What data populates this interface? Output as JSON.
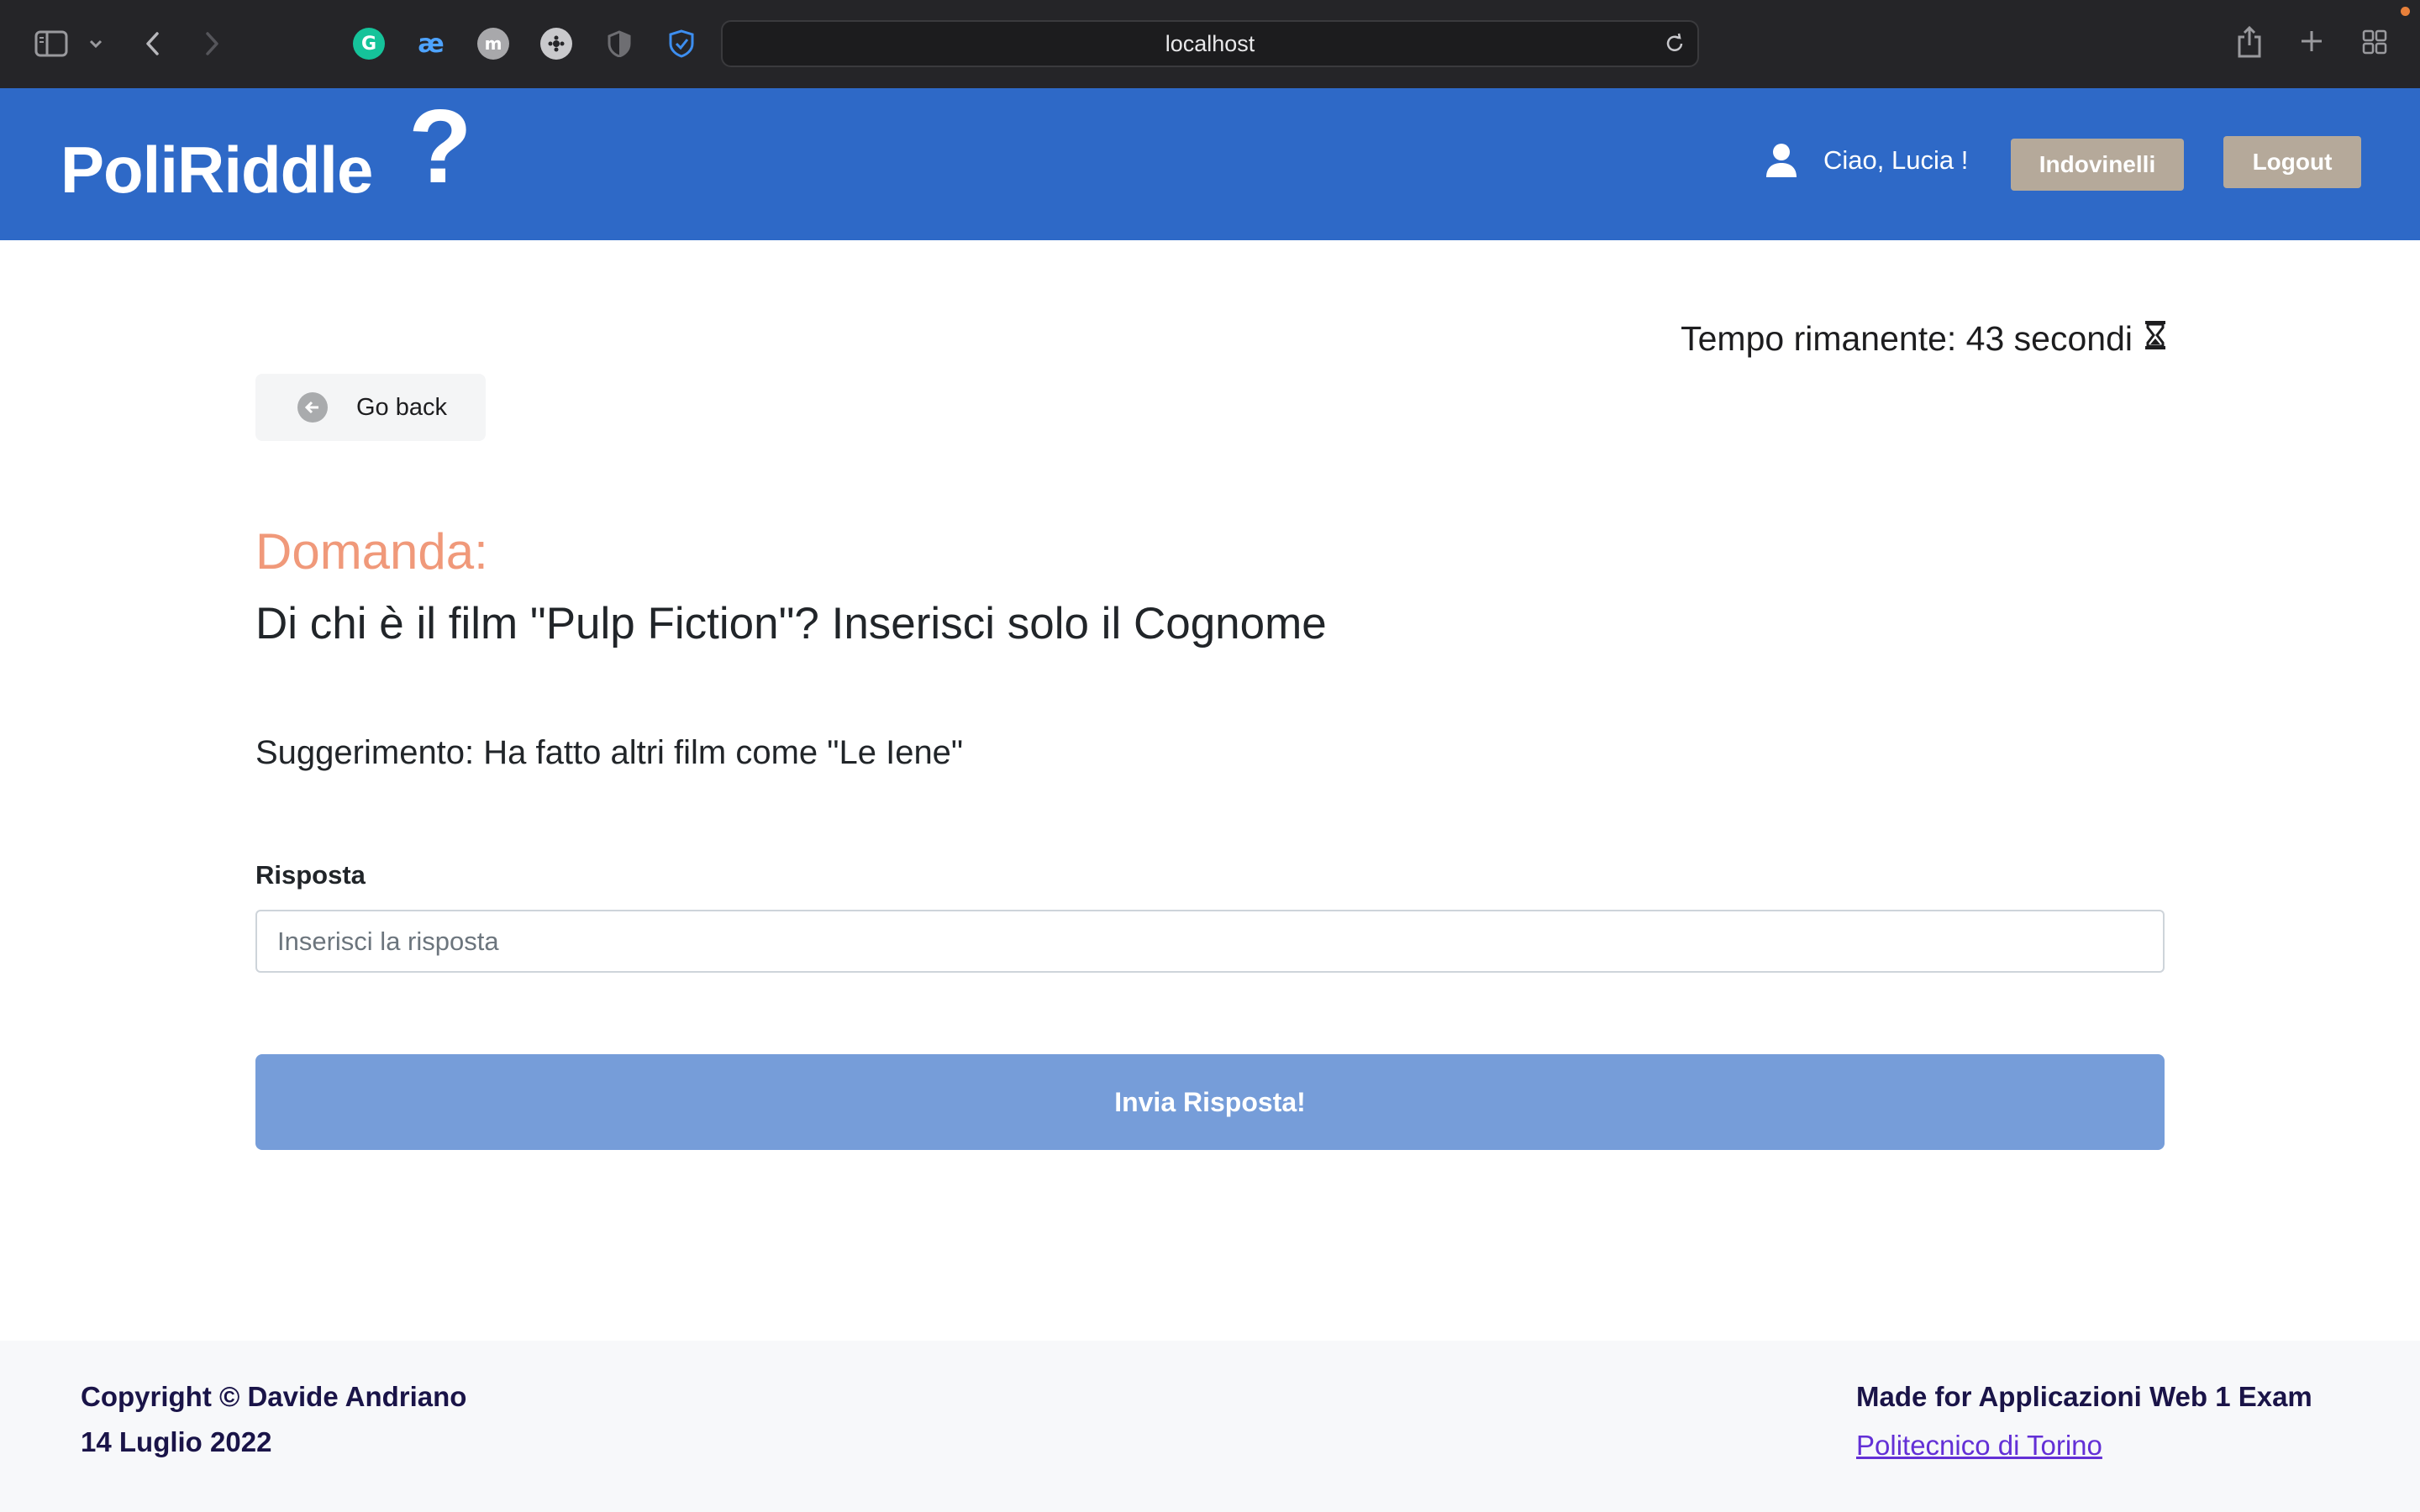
{
  "browser": {
    "url": "localhost",
    "colors": {
      "chrome_bg": "#252528"
    }
  },
  "navbar": {
    "brand": "PoliRiddle",
    "brand_mark": "?",
    "greeting": "Ciao, Lucia !",
    "riddles_button": "Indovinelli",
    "logout_button": "Logout",
    "colors": {
      "background": "#2e69c7",
      "button": "#b5a99a"
    }
  },
  "main": {
    "timer": "Tempo rimanente: 43 secondi",
    "go_back": "Go back",
    "question_label": "Domanda:",
    "question_text": "Di chi è il film \"Pulp Fiction\"? Inserisci solo il Cognome",
    "hint": "Suggerimento: Ha fatto altri film come \"Le Iene\"",
    "answer_label": "Risposta",
    "answer_placeholder": "Inserisci la risposta",
    "answer_value": "",
    "submit_button": "Invia Risposta!",
    "colors": {
      "question_label": "#f0997a",
      "submit": "#769dd9"
    }
  },
  "footer": {
    "copyright": "Copyright © Davide Andriano",
    "date": "14 Luglio 2022",
    "made_for": "Made for Applicazioni Web 1 Exam",
    "university_link": "Politecnico di Torino"
  },
  "icons": [
    "sidebar-icon",
    "chevron-down-icon",
    "back-arrow-icon",
    "forward-arrow-icon",
    "reload-icon",
    "share-icon",
    "plus-icon",
    "tab-overview-icon",
    "user-icon",
    "hourglass-icon",
    "arrow-left-circle-icon"
  ]
}
